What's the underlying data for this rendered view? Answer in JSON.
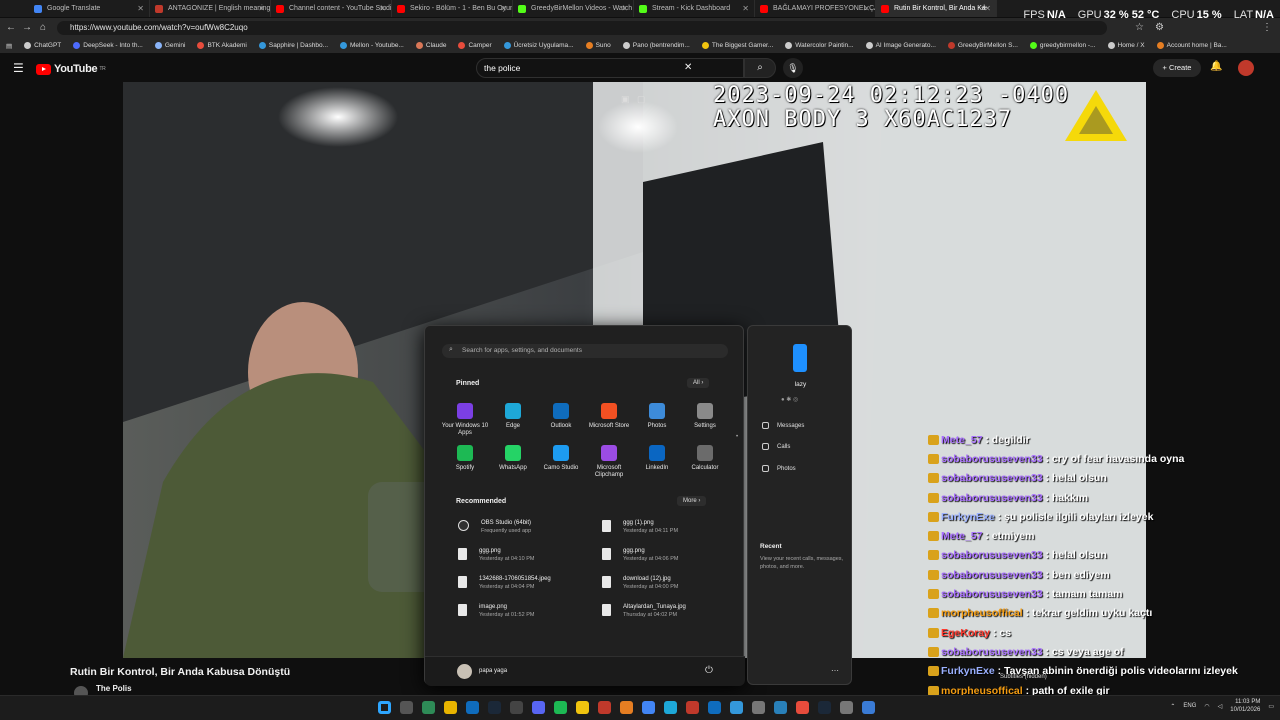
{
  "browser": {
    "tabs": [
      {
        "label": "Google Translate",
        "color": "#4285f4"
      },
      {
        "label": "ANTAGONIZE | English meaning -",
        "color": "#c0392b"
      },
      {
        "label": "Channel content - YouTube Studio",
        "color": "#ff0000"
      },
      {
        "label": "Sekiro - Bölüm - 1 - Ben Bu Oyun",
        "color": "#ff0000"
      },
      {
        "label": "GreedyBirMellon Videos - Watch",
        "color": "#53fc18"
      },
      {
        "label": "Stream - Kick Dashboard",
        "color": "#53fc18"
      },
      {
        "label": "BAĞLAMAYI PROFESYONEL ÇALM",
        "color": "#ff0000"
      },
      {
        "label": "Rutin Bir Kontrol, Bir Anda Ka",
        "color": "#ff0000"
      }
    ],
    "url": "https://www.youtube.com/watch?v=oufWw8C2uqo",
    "bookmarks": [
      {
        "label": "ChatGPT",
        "color": "#cccccc"
      },
      {
        "label": "DeepSeek - Into th...",
        "color": "#4d6bfe"
      },
      {
        "label": "Gemini",
        "color": "#8ab4f8"
      },
      {
        "label": "BTK Akademi",
        "color": "#e74c3c"
      },
      {
        "label": "Sapphire | Dashbo...",
        "color": "#3498db"
      },
      {
        "label": "Mellon - Youtube...",
        "color": "#3498db"
      },
      {
        "label": "Claude",
        "color": "#d97757"
      },
      {
        "label": "Camper",
        "color": "#e74c3c"
      },
      {
        "label": "Ücretsiz Uygulama...",
        "color": "#3498db"
      },
      {
        "label": "Suno",
        "color": "#e67e22"
      },
      {
        "label": "Pano (bentrendim...",
        "color": "#cccccc"
      },
      {
        "label": "The Biggest Gamer...",
        "color": "#f1c40f"
      },
      {
        "label": "Watercolor Paintin...",
        "color": "#cccccc"
      },
      {
        "label": "AI Image Generato...",
        "color": "#cccccc"
      },
      {
        "label": "GreedyBirMellon S...",
        "color": "#c0392b"
      },
      {
        "label": "greedybirmellon -...",
        "color": "#53fc18"
      },
      {
        "label": "Home / X",
        "color": "#cccccc"
      },
      {
        "label": "Account home | Ba...",
        "color": "#e67e22"
      }
    ]
  },
  "hud": {
    "fps_label": "FPS",
    "fps_value": "N/A",
    "gpu_label": "GPU",
    "gpu_value": "32 % 52 °C",
    "cpu_label": "CPU",
    "cpu_value": "15 %",
    "lat_label": "LAT",
    "lat_value": "N/A"
  },
  "youtube": {
    "logo": "YouTube",
    "country": "TR",
    "search_query": "the police",
    "create_label": "Create"
  },
  "video": {
    "timestamp": "2023-09-24 02:12:23 -0400",
    "device": "AXON BODY 3 X60AC1237",
    "title": "Rutin Bir Kontrol, Bir Anda Kabusa Dönüştü",
    "channel": "The Polis"
  },
  "chat": [
    {
      "user": "Mete_57",
      "user_color": "#a970ff",
      "text": "degildir"
    },
    {
      "user": "sobaborususeven33",
      "user_color": "#a970ff",
      "text": "cry of fear havasında oyna"
    },
    {
      "user": "sobaborususeven33",
      "user_color": "#a970ff",
      "text": "helal olsun"
    },
    {
      "user": "sobaborususeven33",
      "user_color": "#a970ff",
      "text": "hakkım"
    },
    {
      "user": "FurkynExe",
      "user_color": "#9ab0ff",
      "text": "şu polisle ilgili olayları izleyek"
    },
    {
      "user": "Mete_57",
      "user_color": "#a970ff",
      "text": "etmiyem"
    },
    {
      "user": "sobaborususeven33",
      "user_color": "#a970ff",
      "text": "helal olsun"
    },
    {
      "user": "sobaborususeven33",
      "user_color": "#a970ff",
      "text": "ben ediyem"
    },
    {
      "user": "sobaborususeven33",
      "user_color": "#a970ff",
      "text": "tamam tamam"
    },
    {
      "user": "morpheusoffical",
      "user_color": "#f39c12",
      "text": "tekrar geldim uyku kaçtı"
    },
    {
      "user": "EgeKoray",
      "user_color": "#ff3b30",
      "text": "cs"
    },
    {
      "user": "sobaborususeven33",
      "user_color": "#a970ff",
      "text": "cs veya age of"
    },
    {
      "user": "FurkynExe",
      "user_color": "#9ab0ff",
      "text": "Tavşan abinin önerdiği polis videolarını izleyek"
    },
    {
      "user": "morpheusoffical",
      "user_color": "#f39c12",
      "text": "path of exile gir"
    }
  ],
  "start_menu": {
    "search_placeholder": "Search for apps, settings, and documents",
    "pinned_label": "Pinned",
    "all_label": "All",
    "pinned": [
      {
        "label": "Your Windows 10 Apps",
        "color": "#7b3fe4"
      },
      {
        "label": "Edge",
        "color": "#1ea8d8"
      },
      {
        "label": "Outlook",
        "color": "#0f6cbd"
      },
      {
        "label": "Microsoft Store",
        "color": "#f25022"
      },
      {
        "label": "Photos",
        "color": "#3d8bd9"
      },
      {
        "label": "Settings",
        "color": "#8a8a8a"
      },
      {
        "label": "Spotify",
        "color": "#1db954"
      },
      {
        "label": "WhatsApp",
        "color": "#25d366"
      },
      {
        "label": "Camo Studio",
        "color": "#1d9bf0"
      },
      {
        "label": "Microsoft Clipchamp",
        "color": "#9b4ce4"
      },
      {
        "label": "LinkedIn",
        "color": "#0a66c2"
      },
      {
        "label": "Calculator",
        "color": "#6b6b6b"
      }
    ],
    "recommended_label": "Recommended",
    "more_label": "More",
    "recommended": [
      {
        "name": "OBS Studio (64bit)",
        "sub": "Frequently used app"
      },
      {
        "name": "ggg (1).png",
        "sub": "Yesterday at 04:11 PM"
      },
      {
        "name": "ggg.png",
        "sub": "Yesterday at 04:10 PM"
      },
      {
        "name": "ggg.png",
        "sub": "Yesterday at 04:06 PM"
      },
      {
        "name": "1342688-1706051854.jpeg",
        "sub": "Yesterday at 04:04 PM"
      },
      {
        "name": "download (12).jpg",
        "sub": "Yesterday at 04:00 PM"
      },
      {
        "name": "image.png",
        "sub": "Yesterday at 01:52 PM"
      },
      {
        "name": "Altaylardan_Tunaya.jpg",
        "sub": "Thursday at 04:02 PM"
      }
    ],
    "user": "papa yaga"
  },
  "phone_link": {
    "device": "lazy",
    "items": [
      "Messages",
      "Calls",
      "Photos"
    ],
    "recent_title": "Recent",
    "recent_text": "View your recent calls, messages, photos, and more."
  },
  "player": {
    "subtitles": "Subtitles (hidden)"
  },
  "taskbar": {
    "lang": "ENG",
    "time": "11:03 PM",
    "date": "10/01/2026"
  }
}
